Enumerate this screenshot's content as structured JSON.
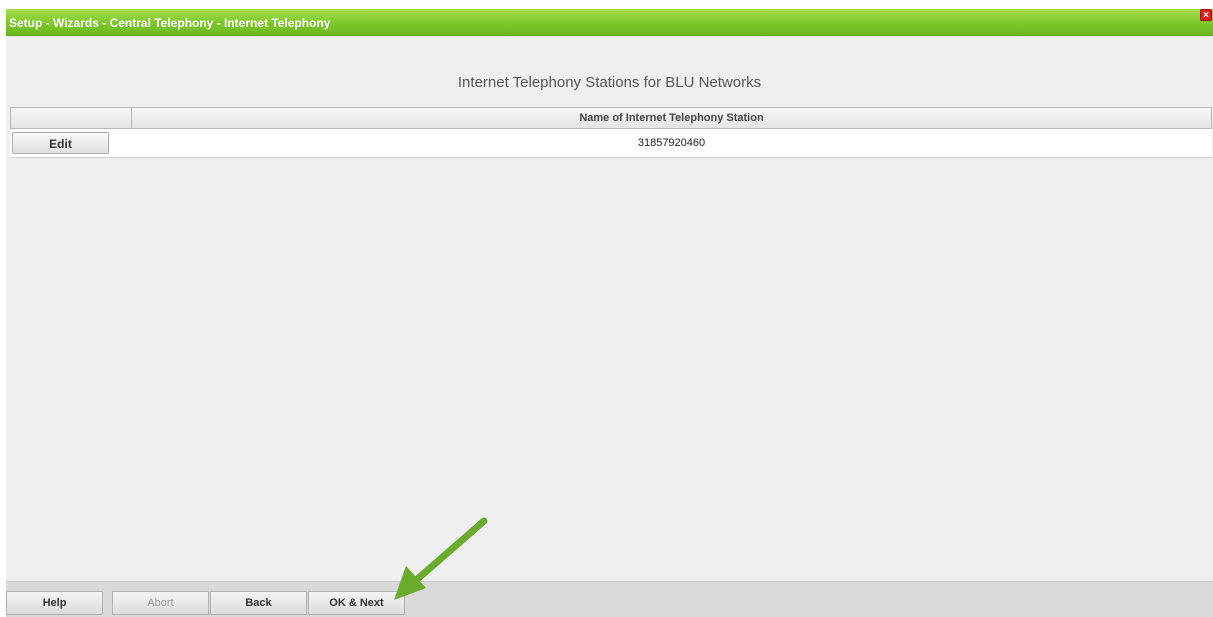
{
  "window": {
    "title": "Setup - Wizards - Central Telephony - Internet Telephony",
    "close_glyph": "×"
  },
  "page": {
    "heading": "Internet Telephony Stations for BLU Networks"
  },
  "table": {
    "columns": [
      "",
      "Name of Internet Telephony Station"
    ],
    "rows": [
      {
        "action_label": "Edit",
        "name": "31857920460"
      }
    ]
  },
  "footer": {
    "help_label": "Help",
    "abort_label": "Abort",
    "back_label": "Back",
    "ok_next_label": "OK & Next"
  },
  "annotation": {
    "arrow_color": "#6aab2e",
    "arrow_icon": "arrow-pointer-icon"
  },
  "colors": {
    "titlebar": "#7cc62a",
    "background": "#efefef",
    "close_button": "#e0201c"
  }
}
